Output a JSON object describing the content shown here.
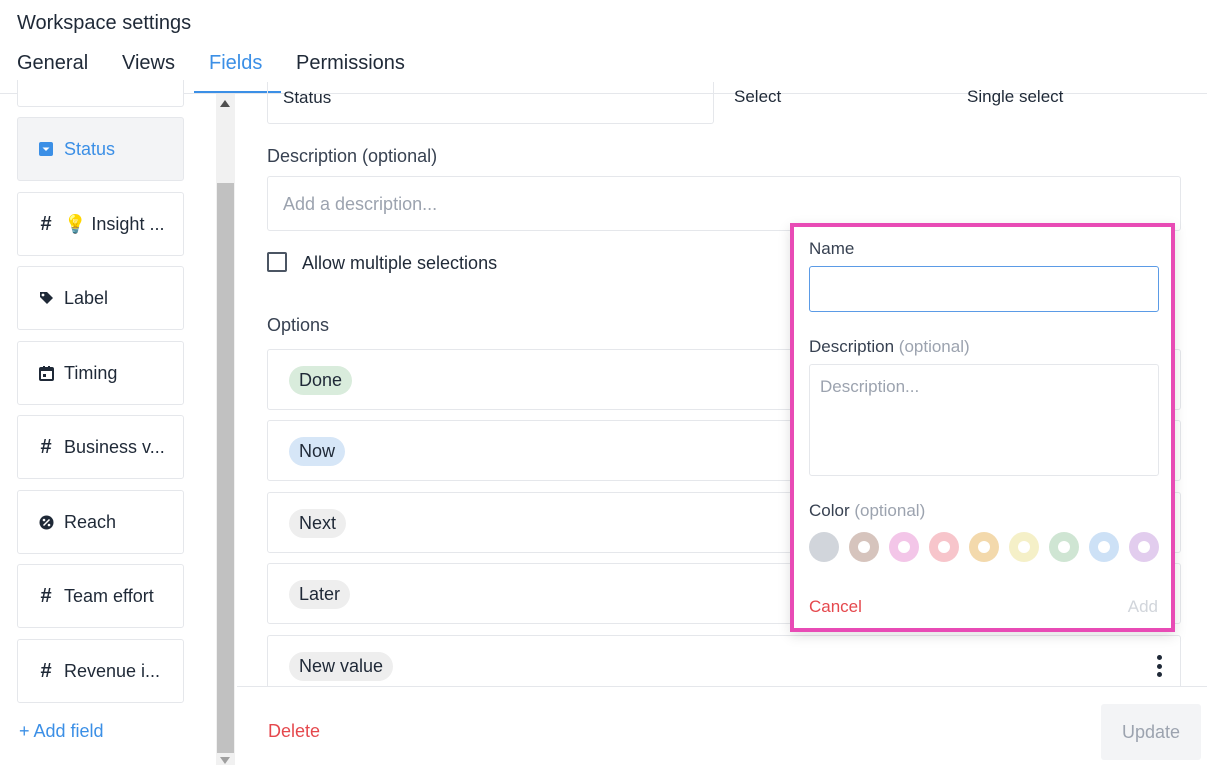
{
  "header": {
    "title": "Workspace settings"
  },
  "tabs": [
    {
      "label": "General"
    },
    {
      "label": "Views"
    },
    {
      "label": "Fields"
    },
    {
      "label": "Permissions"
    }
  ],
  "sidebar": {
    "items": [
      {
        "label": "Status",
        "icon": "dropdown-icon"
      },
      {
        "label": "💡 Insight ...",
        "icon": "hash-icon"
      },
      {
        "label": "Label",
        "icon": "tag-icon"
      },
      {
        "label": "Timing",
        "icon": "calendar-icon"
      },
      {
        "label": "Business v...",
        "icon": "hash-icon"
      },
      {
        "label": "Reach",
        "icon": "percent-icon"
      },
      {
        "label": "Team effort",
        "icon": "hash-icon"
      },
      {
        "label": "Revenue i...",
        "icon": "hash-icon"
      }
    ],
    "add_field": "+ Add field"
  },
  "field": {
    "name_value": "Status",
    "type_label": "Select",
    "subtype_label": "Single select",
    "description_label": "Description (optional)",
    "description_placeholder": "Add a description...",
    "allow_multiple_label": "Allow multiple selections",
    "options_label": "Options",
    "options": [
      {
        "label": "Done",
        "color": "#d9ecdc"
      },
      {
        "label": "Now",
        "color": "#d6e6f7"
      },
      {
        "label": "Next",
        "color": "#eeeeee"
      },
      {
        "label": "Later",
        "color": "#eeeeee"
      },
      {
        "label": "New value",
        "color": "#eeeeee"
      }
    ]
  },
  "footer": {
    "delete_label": "Delete",
    "update_label": "Update"
  },
  "popover": {
    "name_label": "Name",
    "name_value": "",
    "description_label": "Description",
    "description_optional": "(optional)",
    "description_placeholder": "Description...",
    "color_label": "Color",
    "color_optional": "(optional)",
    "colors": [
      "#d1d5db",
      "#d6c4bd",
      "#f3c6e8",
      "#f7c5cb",
      "#f3d9ac",
      "#f5f0c8",
      "#cfe5d3",
      "#cde1f6",
      "#e2cdee"
    ],
    "cancel_label": "Cancel",
    "add_label": "Add"
  },
  "accent_color": "#3b8fe6",
  "highlight_color": "#e84bb5"
}
